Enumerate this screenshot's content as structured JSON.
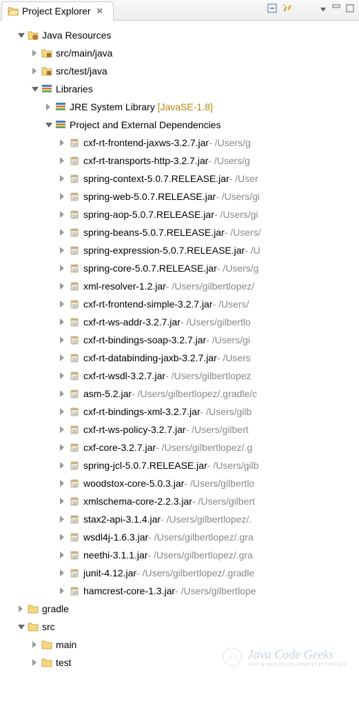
{
  "tab": {
    "title": "Project Explorer"
  },
  "tree": {
    "root": {
      "label": "Java Resources",
      "children": {
        "src_main": "src/main/java",
        "src_test": "src/test/java",
        "libraries": {
          "label": "Libraries",
          "jre": {
            "label": "JRE System Library",
            "bracket": "[JavaSE-1.8]"
          },
          "ext_deps": {
            "label": "Project and External Dependencies",
            "jars": [
              {
                "name": "cxf-rt-frontend-jaxws-3.2.7.jar",
                "path": " - /Users/g"
              },
              {
                "name": "cxf-rt-transports-http-3.2.7.jar",
                "path": " - /Users/g"
              },
              {
                "name": "spring-context-5.0.7.RELEASE.jar",
                "path": " - /User"
              },
              {
                "name": "spring-web-5.0.7.RELEASE.jar",
                "path": " - /Users/gi"
              },
              {
                "name": "spring-aop-5.0.7.RELEASE.jar",
                "path": " - /Users/gi"
              },
              {
                "name": "spring-beans-5.0.7.RELEASE.jar",
                "path": " - /Users/"
              },
              {
                "name": "spring-expression-5.0.7.RELEASE.jar",
                "path": " - /U"
              },
              {
                "name": "spring-core-5.0.7.RELEASE.jar",
                "path": " - /Users/g"
              },
              {
                "name": "xml-resolver-1.2.jar",
                "path": " - /Users/gilbertlopez/"
              },
              {
                "name": "cxf-rt-frontend-simple-3.2.7.jar",
                "path": " - /Users/"
              },
              {
                "name": "cxf-rt-ws-addr-3.2.7.jar",
                "path": " - /Users/gilbertlo"
              },
              {
                "name": "cxf-rt-bindings-soap-3.2.7.jar",
                "path": " - /Users/gi"
              },
              {
                "name": "cxf-rt-databinding-jaxb-3.2.7.jar",
                "path": " - /Users"
              },
              {
                "name": "cxf-rt-wsdl-3.2.7.jar",
                "path": " - /Users/gilbertlopez"
              },
              {
                "name": "asm-5.2.jar",
                "path": " - /Users/gilbertlopez/.gradle/c"
              },
              {
                "name": "cxf-rt-bindings-xml-3.2.7.jar",
                "path": " - /Users/gilb"
              },
              {
                "name": "cxf-rt-ws-policy-3.2.7.jar",
                "path": " - /Users/gilbert"
              },
              {
                "name": "cxf-core-3.2.7.jar",
                "path": " - /Users/gilbertlopez/.g"
              },
              {
                "name": "spring-jcl-5.0.7.RELEASE.jar",
                "path": " - /Users/gilb"
              },
              {
                "name": "woodstox-core-5.0.3.jar",
                "path": " - /Users/gilbertlo"
              },
              {
                "name": "xmlschema-core-2.2.3.jar",
                "path": " - /Users/gilbert"
              },
              {
                "name": "stax2-api-3.1.4.jar",
                "path": " - /Users/gilbertlopez/."
              },
              {
                "name": "wsdl4j-1.6.3.jar",
                "path": " - /Users/gilbertlopez/.gra"
              },
              {
                "name": "neethi-3.1.1.jar",
                "path": " - /Users/gilbertlopez/.gra"
              },
              {
                "name": "junit-4.12.jar",
                "path": " - /Users/gilbertlopez/.gradle"
              },
              {
                "name": "hamcrest-core-1.3.jar",
                "path": " - /Users/gilbertlope"
              }
            ]
          }
        }
      }
    },
    "gradle": "gradle",
    "src": {
      "label": "src",
      "main": "main",
      "test": "test"
    }
  },
  "watermark": {
    "brand": "Java Code Geeks",
    "sub": "JAVA & WEB DEVELOPMENT TUTORIALS"
  }
}
